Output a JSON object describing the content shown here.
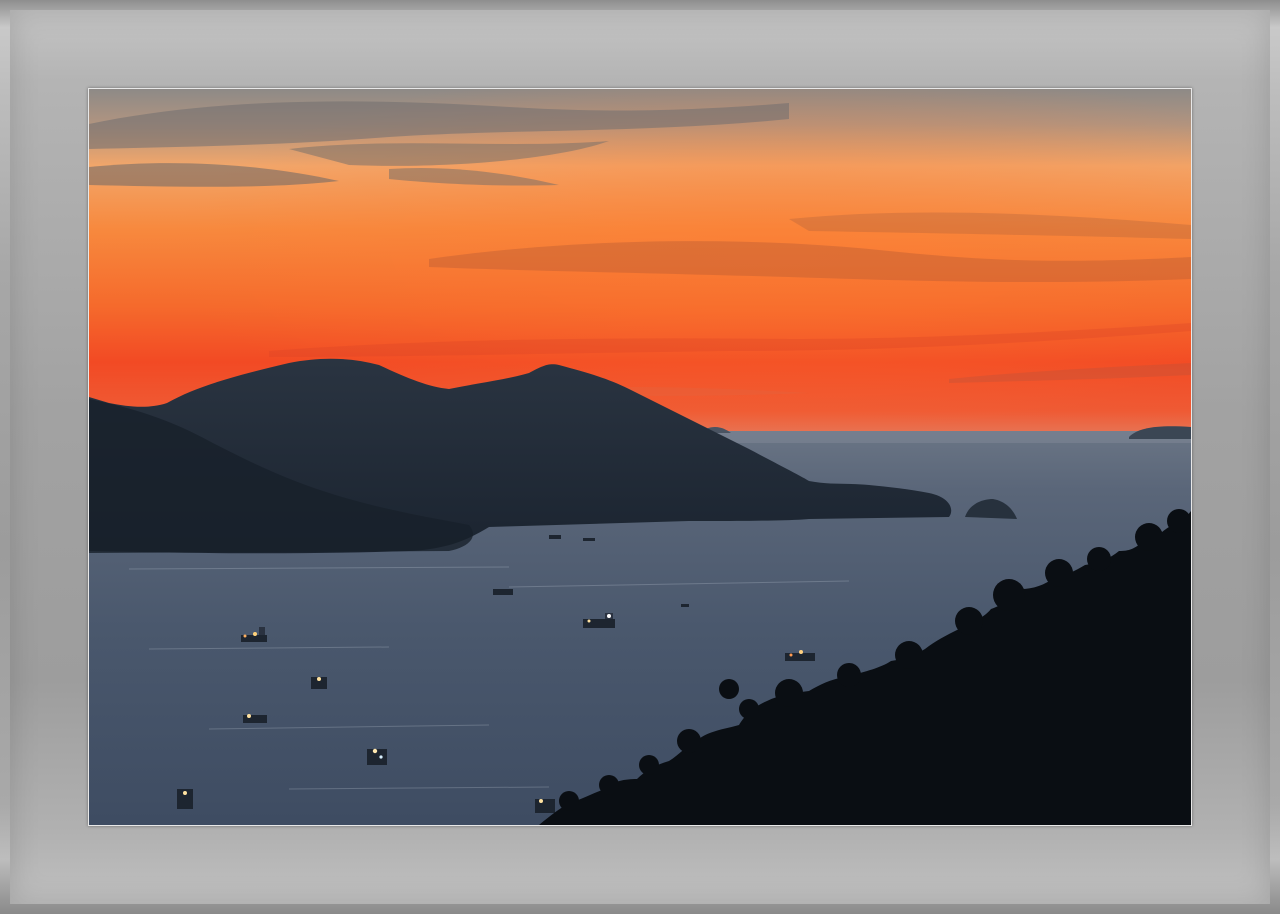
{
  "image": {
    "subject": "sunset-over-bay",
    "colors": {
      "sky_top": "#8f8a86",
      "sky_orange": "#f47a36",
      "sky_red": "#f04a22",
      "horizon_glow": "#ff5a1c",
      "sea": "#4b5b70",
      "mountain": "#1f2a36",
      "trees": "#0b0f14",
      "mat": "#a6a6a6"
    }
  }
}
